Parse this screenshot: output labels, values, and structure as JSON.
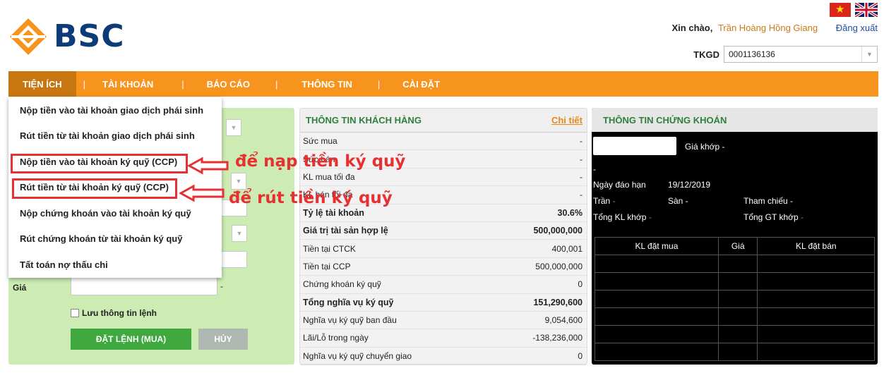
{
  "brand": {
    "name": "BSC"
  },
  "header": {
    "greeting": "Xin chào,",
    "user_name": "Trần Hoàng Hồng Giang",
    "logout": "Đăng xuất",
    "account_label": "TKGD",
    "account_value": "0001136136"
  },
  "nav": {
    "items": [
      "TIỆN ÍCH",
      "TÀI KHOẢN",
      "BÁO CÁO",
      "THÔNG TIN",
      "CÀI ĐẶT"
    ],
    "separator": "|"
  },
  "dropdown": {
    "items": [
      "Nộp tiền vào tài khoản giao dịch phái sinh",
      "Rút tiền từ tài khoản giao dịch phái sinh",
      "Nộp tiền vào tài khoản ký quỹ (CCP)",
      "Rút tiền từ tài khoản ký quỹ (CCP)",
      "Nộp chứng khoán vào tài khoản ký quỹ",
      "Rút chứng khoán từ tài khoản ký quỹ",
      "Tất toán nợ thấu chi"
    ]
  },
  "annotations": {
    "deposit": "để nạp tiền ký quỹ",
    "withdraw": "để rút tiền ký quỹ"
  },
  "order": {
    "price_label": "Giá",
    "dash": "-",
    "save_label": "Lưu thông tin lệnh",
    "buy_button": "ĐẶT LỆNH (MUA)",
    "cancel_button": "HỦY"
  },
  "customer": {
    "title": "THÔNG TIN KHÁCH HÀNG",
    "detail_link": "Chi tiết",
    "rows": [
      {
        "label": "Sức mua",
        "value": "-",
        "bold": false
      },
      {
        "label": "Sức bán",
        "value": "-",
        "bold": false
      },
      {
        "label": "KL mua tối đa",
        "value": "-",
        "bold": false
      },
      {
        "label": "KL bán tối đa",
        "value": "-",
        "bold": false
      },
      {
        "label": "Tỷ lệ tài khoản",
        "value": "30.6%",
        "bold": true
      },
      {
        "label": "Giá trị tài sản hợp lệ",
        "value": "500,000,000",
        "bold": true
      },
      {
        "label": "Tiền tại CTCK",
        "value": "400,001",
        "bold": false
      },
      {
        "label": "Tiền tại CCP",
        "value": "500,000,000",
        "bold": false
      },
      {
        "label": "Chứng khoán ký quỹ",
        "value": "0",
        "bold": false
      },
      {
        "label": "Tổng nghĩa vụ ký quỹ",
        "value": "151,290,600",
        "bold": true
      },
      {
        "label": "Nghĩa vụ ký quỹ ban đầu",
        "value": "9,054,600",
        "bold": false
      },
      {
        "label": "Lãi/Lỗ trong ngày",
        "value": "-138,236,000",
        "bold": false
      },
      {
        "label": "Nghĩa vụ ký quỹ chuyển giao",
        "value": "0",
        "bold": false
      }
    ]
  },
  "stock": {
    "title": "THÔNG TIN CHỨNG KHOÁN",
    "match_price": "Giá khớp -",
    "dash": "-",
    "maturity_label": "Ngày đáo hạn",
    "maturity_value": "19/12/2019",
    "ceiling": "Trần",
    "floor": "Sàn -",
    "reference": "Tham chiếu -",
    "total_vol": "Tổng KL khớp",
    "total_val": "Tổng GT khớp",
    "book_headers": [
      "KL đặt mua",
      "Giá",
      "KL đặt bán"
    ]
  }
}
